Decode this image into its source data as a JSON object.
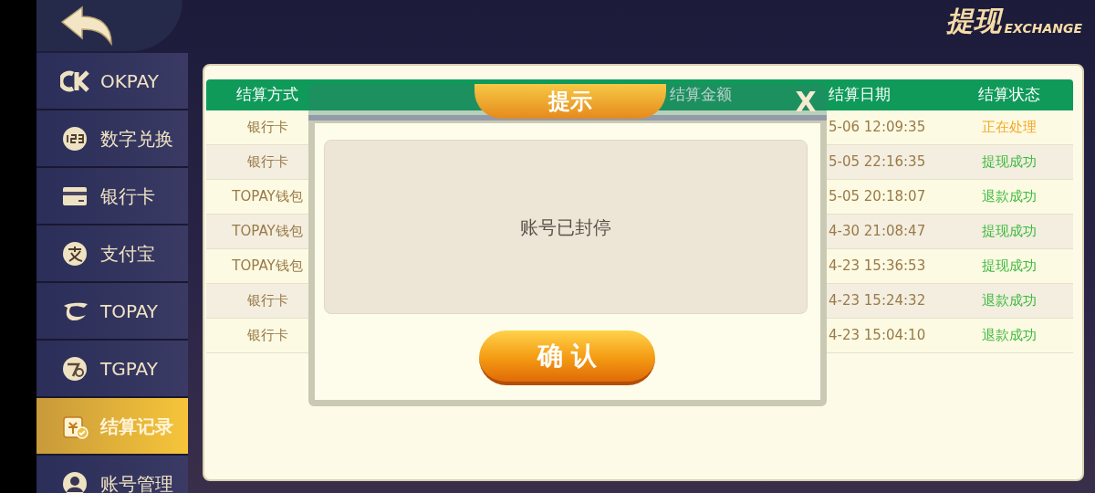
{
  "header": {
    "title": "提现",
    "subtitle": "EXCHANGE"
  },
  "sidebar": {
    "items": [
      {
        "label": "OKPAY",
        "kind": "ck",
        "selected": false
      },
      {
        "label": "数字兑换",
        "kind": "numbers",
        "selected": false
      },
      {
        "label": "银行卡",
        "kind": "card",
        "selected": false
      },
      {
        "label": "支付宝",
        "kind": "pay",
        "selected": false
      },
      {
        "label": "TOPAY",
        "kind": "swoosh",
        "selected": false
      },
      {
        "label": "TGPAY",
        "kind": "tg",
        "selected": false
      },
      {
        "label": "结算记录",
        "kind": "record",
        "selected": true
      },
      {
        "label": "账号管理",
        "kind": "user",
        "selected": false
      }
    ]
  },
  "table": {
    "columns": [
      "结算方式",
      "结算金额",
      "结算日期",
      "结算状态"
    ],
    "rows": [
      {
        "method": "银行卡",
        "date": "5-06 12:09:35",
        "status": "正在处理",
        "color": "#f5a623"
      },
      {
        "method": "银行卡",
        "date": "5-05 22:16:35",
        "status": "提现成功",
        "color": "#3cb93c"
      },
      {
        "method": "TOPAY钱包",
        "date": "5-05 20:18:07",
        "status": "退款成功",
        "color": "#3cb93c"
      },
      {
        "method": "TOPAY钱包",
        "date": "4-30 21:08:47",
        "status": "提现成功",
        "color": "#3cb93c"
      },
      {
        "method": "TOPAY钱包",
        "date": "4-23 15:36:53",
        "status": "提现成功",
        "color": "#3cb93c"
      },
      {
        "method": "银行卡",
        "date": "4-23 15:24:32",
        "status": "退款成功",
        "color": "#3cb93c"
      },
      {
        "method": "银行卡",
        "date": "4-23 15:04:10",
        "status": "退款成功",
        "color": "#3cb93c"
      }
    ]
  },
  "dialog": {
    "title": "提示",
    "close": "X",
    "message": "账号已封停",
    "button": "确 认"
  }
}
